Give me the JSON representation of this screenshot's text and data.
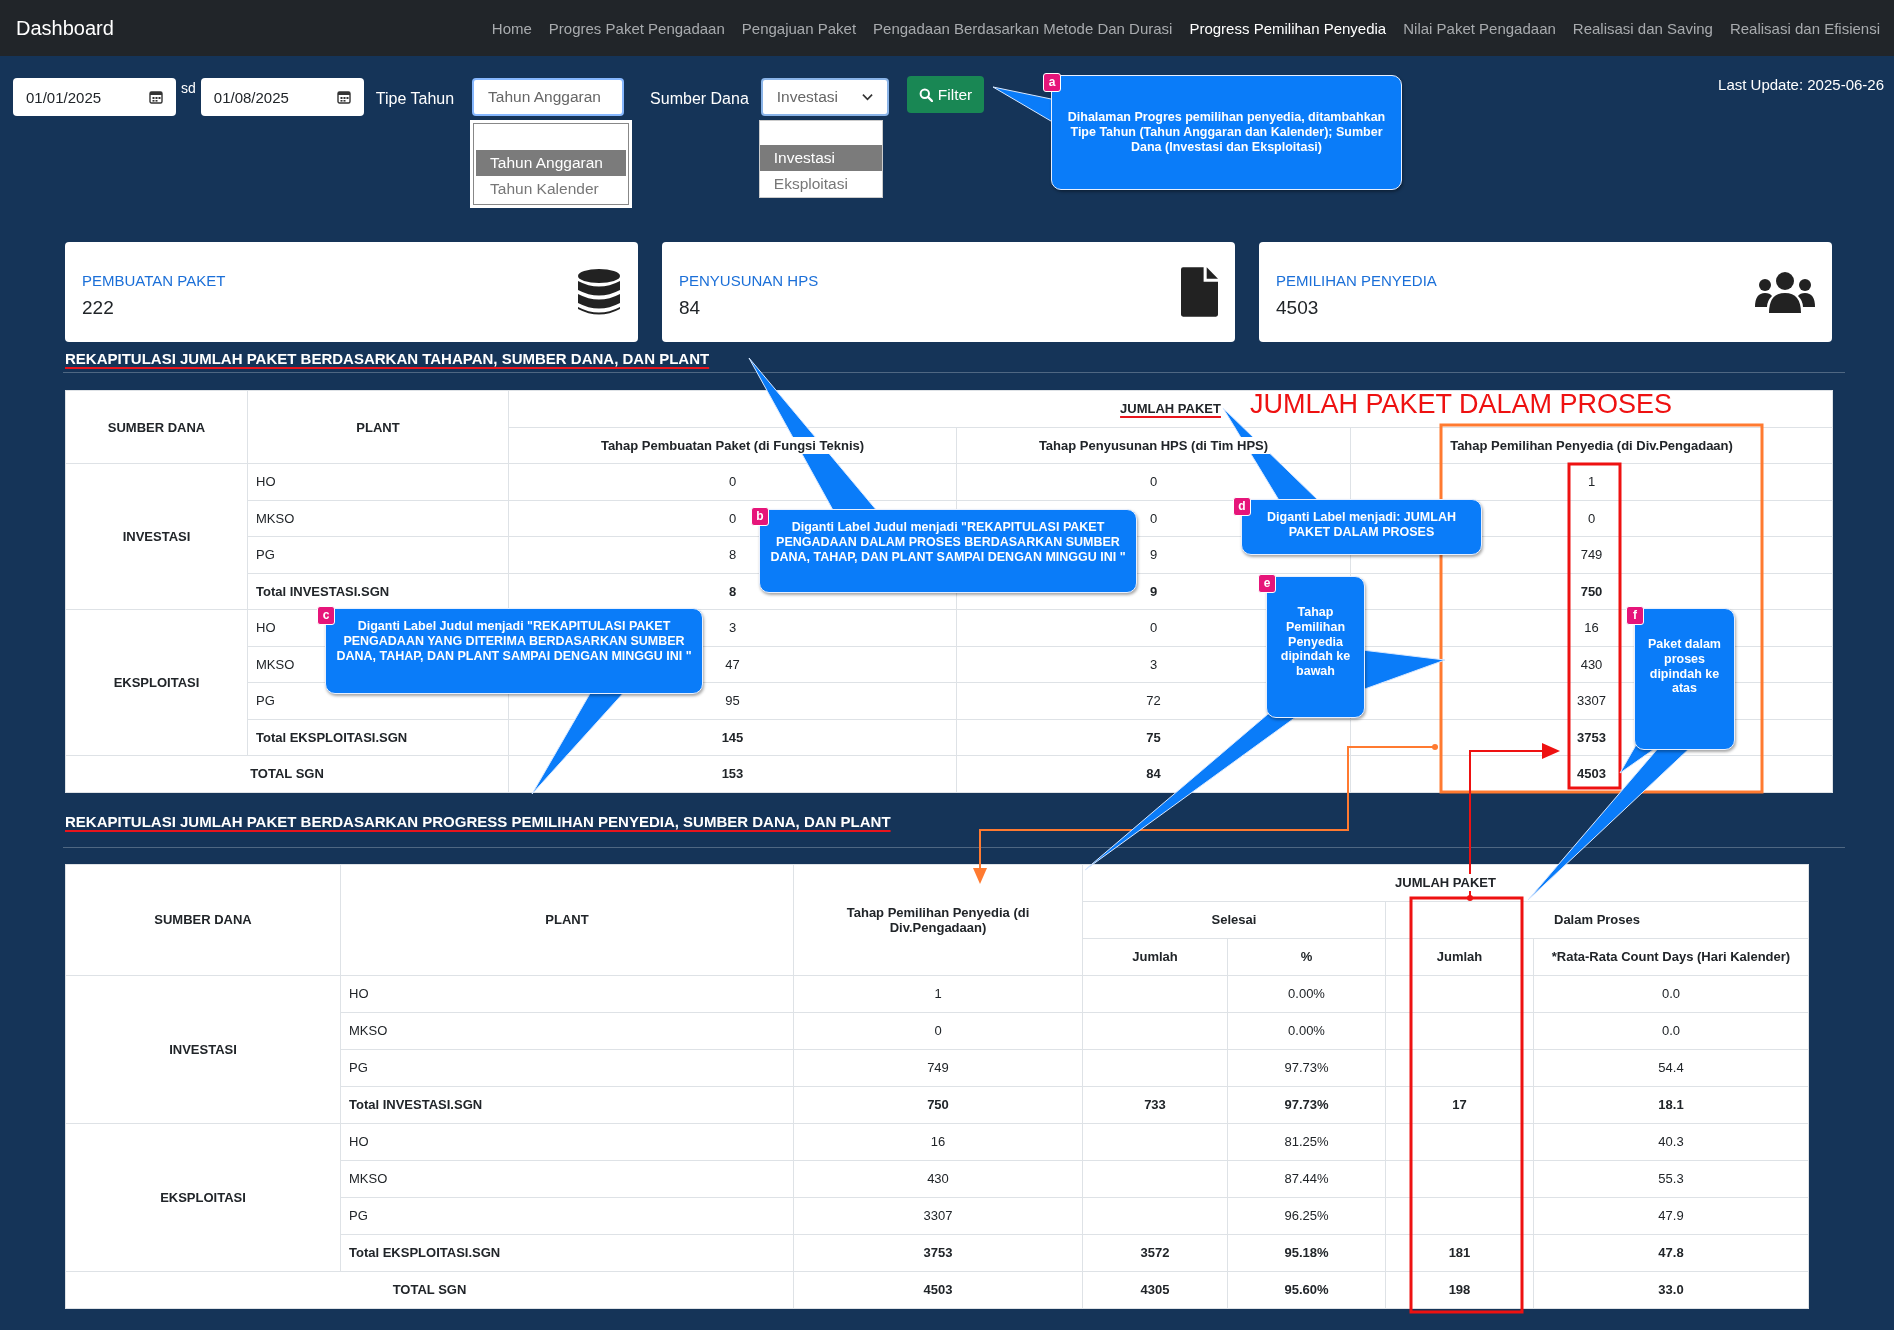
{
  "nav": {
    "brand": "Dashboard",
    "items": [
      {
        "label": "Home",
        "selected": false
      },
      {
        "label": "Progres Paket Pengadaan",
        "selected": false
      },
      {
        "label": "Pengajuan Paket",
        "selected": false
      },
      {
        "label": "Pengadaan Berdasarkan Metode Dan Durasi",
        "selected": false
      },
      {
        "label": "Progress Pemilihan Penyedia",
        "selected": true
      },
      {
        "label": "Nilai Paket Pengadaan",
        "selected": false
      },
      {
        "label": "Realisasi dan Saving",
        "selected": false
      },
      {
        "label": "Realisasi dan Efisiensi",
        "selected": false
      }
    ]
  },
  "filters": {
    "date_from": "01/01/2025",
    "separator": "sd",
    "date_to": "01/08/2025",
    "year_type": {
      "label": "Tipe Tahun",
      "value": "Tahun Anggaran",
      "options": [
        {
          "label": "Tahun Anggaran",
          "selected": true
        },
        {
          "label": "Tahun Kalender",
          "selected": false
        }
      ]
    },
    "fund_source": {
      "label": "Sumber Dana",
      "value": "Investasi",
      "options": [
        {
          "label": "Investasi",
          "selected": true
        },
        {
          "label": "Eksploitasi",
          "selected": false
        }
      ]
    },
    "filter_button": "Filter"
  },
  "last_update": "Last Update: 2025-06-26",
  "cards": [
    {
      "title": "PEMBUATAN PAKET",
      "value": "222"
    },
    {
      "title": "PENYUSUNAN HPS",
      "value": "84"
    },
    {
      "title": "PEMILIHAN PENYEDIA",
      "value": "4503"
    }
  ],
  "section_1": {
    "title": "REKAPITULASI JUMLAH PAKET BERDASARKAN TAHAPAN, SUMBER DANA, DAN PLANT"
  },
  "table_1": {
    "headers": {
      "source": "SUMBER DANA",
      "plant": "PLANT",
      "group": "JUMLAH PAKET",
      "stages": [
        "Tahap Pembuatan Paket (di Fungsi Teknis)",
        "Tahap Penyusunan HPS (di Tim HPS)",
        "Tahap Pemilihan Penyedia (di Div.Pengadaan)"
      ]
    },
    "groups": [
      {
        "name": "INVESTASI",
        "rows": [
          {
            "plant": "HO",
            "values": [
              "0",
              "0",
              "1"
            ]
          },
          {
            "plant": "MKSO",
            "values": [
              "0",
              "0",
              "0"
            ]
          },
          {
            "plant": "PG",
            "values": [
              "8",
              "9",
              "749"
            ]
          }
        ],
        "total": {
          "label": "Total INVESTASI.SGN",
          "values": [
            "8",
            "9",
            "750"
          ]
        }
      },
      {
        "name": "EKSPLOITASI",
        "rows": [
          {
            "plant": "HO",
            "values": [
              "3",
              "0",
              "16"
            ]
          },
          {
            "plant": "MKSO",
            "values": [
              "47",
              "3",
              "430"
            ]
          },
          {
            "plant": "PG",
            "values": [
              "95",
              "72",
              "3307"
            ]
          }
        ],
        "total": {
          "label": "Total EKSPLOITASI.SGN",
          "values": [
            "145",
            "75",
            "3753"
          ]
        }
      }
    ],
    "grand_total": {
      "label": "TOTAL SGN",
      "values": [
        "153",
        "84",
        "4503"
      ]
    }
  },
  "section_2": {
    "title": "REKAPITULASI JUMLAH PAKET BERDASARKAN PROGRESS PEMILIHAN PENYEDIA, SUMBER DANA, DAN PLANT"
  },
  "table_2": {
    "headers": {
      "source": "SUMBER DANA",
      "plant": "PLANT",
      "stage": "Tahap Pemilihan Penyedia (di Div.Pengadaan)",
      "group": "JUMLAH PAKET",
      "done": "Selesai",
      "in_process": "Dalam Proses",
      "done_count": "Jumlah",
      "done_pct": "%",
      "process_count": "Jumlah",
      "process_days": "*Rata-Rata Count Days (Hari Kalender)"
    },
    "groups": [
      {
        "name": "INVESTASI",
        "rows": [
          {
            "plant": "HO",
            "stage": "1",
            "pct": "0.00%",
            "days": "0.0"
          },
          {
            "plant": "MKSO",
            "stage": "0",
            "pct": "0.00%",
            "days": "0.0"
          },
          {
            "plant": "PG",
            "stage": "749",
            "pct": "97.73%",
            "days": "54.4"
          }
        ],
        "total": {
          "label": "Total INVESTASI.SGN",
          "stage": "750",
          "done": "733",
          "pct": "97.73%",
          "process": "17",
          "days": "18.1"
        }
      },
      {
        "name": "EKSPLOITASI",
        "rows": [
          {
            "plant": "HO",
            "stage": "16",
            "pct": "81.25%",
            "days": "40.3"
          },
          {
            "plant": "MKSO",
            "stage": "430",
            "pct": "87.44%",
            "days": "55.3"
          },
          {
            "plant": "PG",
            "stage": "3307",
            "pct": "96.25%",
            "days": "47.9"
          }
        ],
        "total": {
          "label": "Total EKSPLOITASI.SGN",
          "stage": "3753",
          "done": "3572",
          "pct": "95.18%",
          "process": "181",
          "days": "47.8"
        }
      }
    ],
    "grand_total": {
      "label": "TOTAL SGN",
      "stage": "4503",
      "done": "4305",
      "pct": "95.60%",
      "process": "198",
      "days": "33.0"
    }
  },
  "annotations": {
    "heading": "JUMLAH PAKET DALAM PROSES",
    "callouts": [
      {
        "badge": "a",
        "text": "Dihalaman Progres pemilihan penyedia, ditambahkan Tipe Tahun (Tahun Anggaran dan Kalender); Sumber Dana (Investasi dan Eksploitasi)"
      },
      {
        "badge": "b",
        "text": "Diganti Label Judul menjadi \"REKAPITULASI PAKET PENGADAAN DALAM PROSES BERDASARKAN SUMBER DANA, TAHAP, DAN PLANT SAMPAI DENGAN MINGGU INI \""
      },
      {
        "badge": "c",
        "text": "Diganti Label Judul menjadi \"REKAPITULASI PAKET PENGADAAN YANG DITERIMA BERDASARKAN SUMBER DANA, TAHAP, DAN PLANT SAMPAI DENGAN MINGGU INI \""
      },
      {
        "badge": "d",
        "text": "Diganti Label menjadi: JUMLAH PAKET DALAM PROSES"
      },
      {
        "badge": "e",
        "text": "Tahap Pemilihan Penyedia dipindah ke bawah"
      },
      {
        "badge": "f",
        "text": "Paket dalam proses dipindah ke atas"
      }
    ]
  }
}
